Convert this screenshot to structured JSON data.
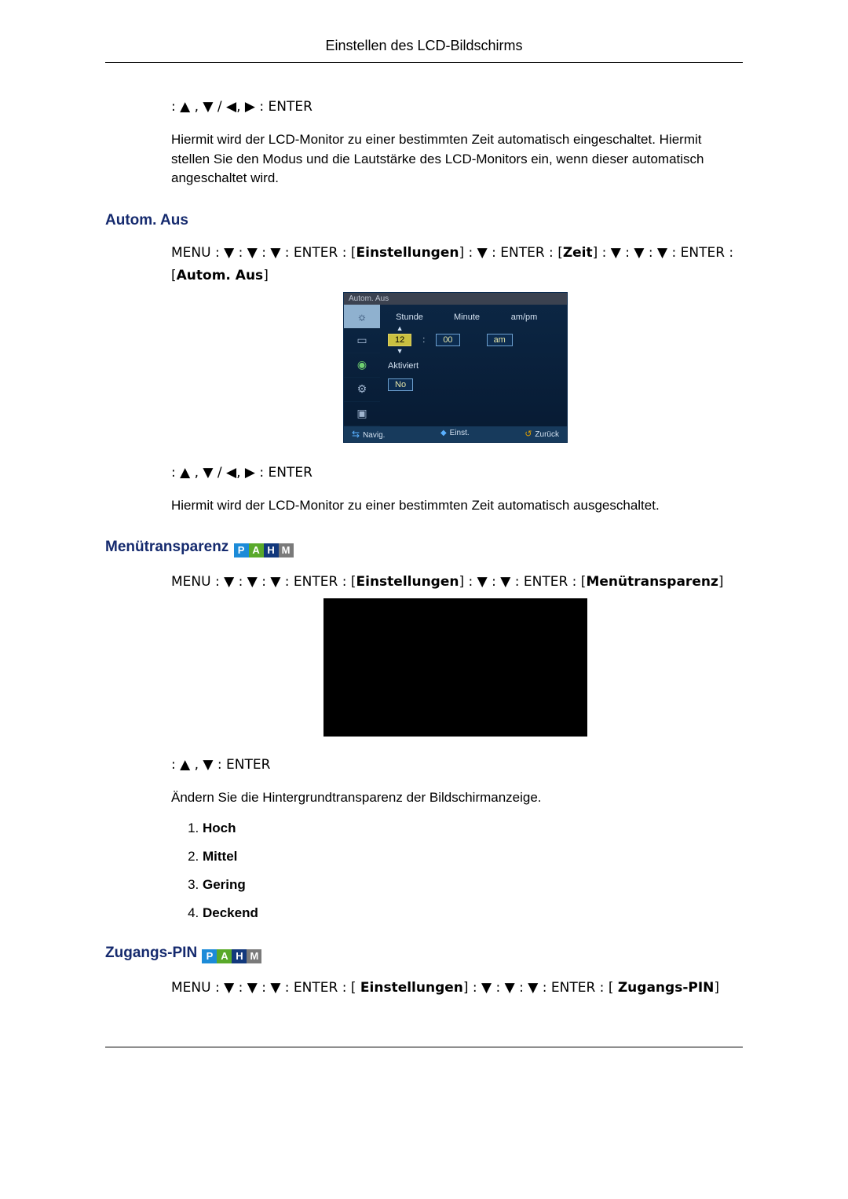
{
  "header": {
    "title": "Einstellen des LCD-Bildschirms"
  },
  "nav": {
    "full": " :  ▲ , ▼ / ◀, ▶  : ENTER",
    "updown": " :  ▲ , ▼  : ENTER"
  },
  "intro": {
    "para": "Hiermit wird der LCD-Monitor zu einer bestimmten Zeit automatisch eingeschaltet. Hiermit stellen Sie den Modus und die Lautstärke des LCD-Monitors ein, wenn dieser automatisch angeschaltet wird."
  },
  "section_autom_aus": {
    "title": "Autom. Aus",
    "path_pre": "MENU  :  ▼ : ▼ : ▼ :  ENTER  :  [",
    "path_b1": "Einstellungen",
    "path_mid1": "]  :  ▼ :  ENTER  :  [",
    "path_b2": "Zeit",
    "path_mid2": "]  :  ▼ :  ▼ :  ▼  : ENTER : [",
    "path_b3": "Autom. Aus",
    "path_post": "]",
    "para_after": "Hiermit wird der LCD-Monitor zu einer bestimmten Zeit automatisch ausgeschaltet."
  },
  "osd": {
    "title": "Autom. Aus",
    "col_hour": "Stunde",
    "col_minute": "Minute",
    "col_ampm": "am/pm",
    "val_hour": "12",
    "val_minute": "00",
    "val_ampm": "am",
    "colon": ":",
    "activated": "Aktiviert",
    "no": "No",
    "foot_nav": "Navig.",
    "foot_set": "Einst.",
    "foot_back": "Zurück"
  },
  "section_menutrans": {
    "title": "Menütransparenz",
    "path_pre": "MENU  :  ▼ : ▼ : ▼ :  ENTER  :  [",
    "path_b1": "Einstellungen",
    "path_mid": "]  :  ▼ :  ▼  :  ENTER  :  [",
    "path_b2": "Menütransparenz",
    "path_post": "]",
    "para": "Ändern Sie die Hintergrundtransparenz der Bildschirmanzeige.",
    "opt1": "Hoch",
    "opt2": "Mittel",
    "opt3": "Gering",
    "opt4": "Deckend"
  },
  "section_pin": {
    "title": "Zugangs-PIN",
    "path_pre": "MENU  :  ▼ : ▼ : ▼  : ENTER   : [ ",
    "path_b1": "Einstellungen",
    "path_mid": "]  :  ▼ :  ▼ :  ▼  : ENTER   : [ ",
    "path_b2": "Zugangs-PIN",
    "path_post": "]"
  },
  "pahm": {
    "p": "P",
    "a": "A",
    "h": "H",
    "m": "M"
  }
}
